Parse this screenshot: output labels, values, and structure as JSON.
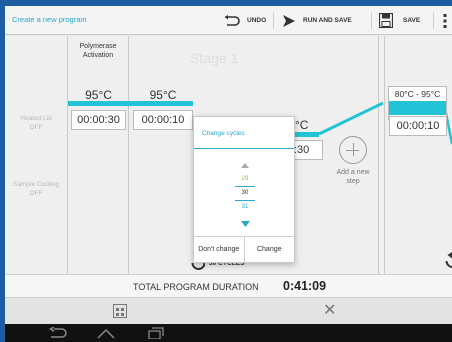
{
  "header": {
    "title": "Create a new program",
    "undo_label": "UNDO",
    "run_save_label": "RUN AND SAVE",
    "save_label": "SAVE"
  },
  "sidebar": {
    "heated_lid_label": "Heated Lid",
    "heated_lid_value": "OFF",
    "sample_cooling_label": "Sample Cooling",
    "sample_cooling_value": "OFF"
  },
  "stage": {
    "name": "Stage 1",
    "cycles_label": "30 CYCLES"
  },
  "steps": [
    {
      "title": "Polymerase Activation",
      "temp": "95°C",
      "time": "00:00:30"
    },
    {
      "title": "",
      "temp": "95°C",
      "time": "00:00:10"
    },
    {
      "title": "",
      "temp": "°C",
      "time": ":30"
    },
    {
      "title": "",
      "temp": "80°C - 95°C",
      "time": "00:00:10"
    }
  ],
  "add_step_label": "Add a new step",
  "dialog": {
    "title": "Change cycles",
    "picker_values": [
      "29",
      "30",
      "31"
    ],
    "dont_change_label": "Don't change",
    "change_label": "Change"
  },
  "footer": {
    "duration_label": "TOTAL PROGRAM DURATION",
    "duration_value": "0:41:09"
  },
  "colors": {
    "accent": "#22c3d6",
    "picker_up": "#8cc63f",
    "picker_down": "#2aa7c9",
    "background_frame": "#1e5ea0"
  },
  "icons": [
    "undo-icon",
    "play-icon",
    "save-icon",
    "overflow-menu-icon",
    "cycle-arrow-icon",
    "grid-icon",
    "close-icon",
    "back-nav-icon",
    "home-nav-icon",
    "recents-nav-icon"
  ]
}
